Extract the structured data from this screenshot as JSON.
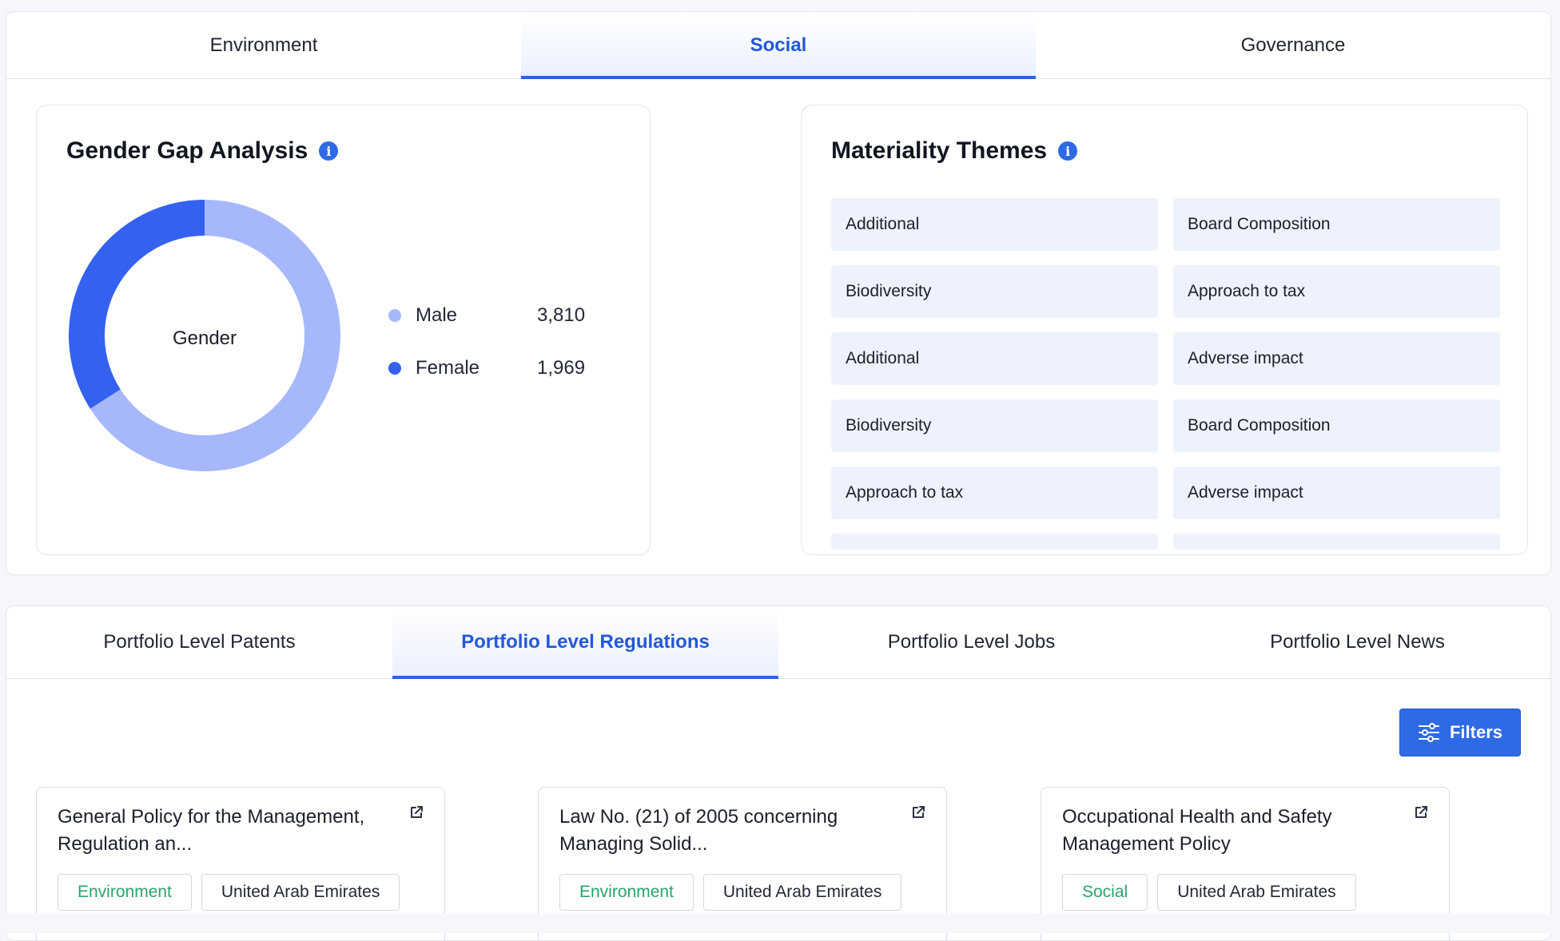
{
  "top_tabs": [
    {
      "label": "Environment",
      "active": false
    },
    {
      "label": "Social",
      "active": true
    },
    {
      "label": "Governance",
      "active": false
    }
  ],
  "gender_gap": {
    "title": "Gender Gap Analysis",
    "center_label": "Gender",
    "chart_data": {
      "type": "pie",
      "categories": [
        "Male",
        "Female"
      ],
      "values": [
        3810,
        1969
      ],
      "display_values": [
        "3,810",
        "1,969"
      ],
      "colors": [
        "#a6b8fb",
        "#3561f0"
      ]
    }
  },
  "materiality": {
    "title": "Materiality Themes",
    "items": [
      "Additional",
      "Board Composition",
      "Biodiversity",
      "Approach to tax",
      "Additional",
      "Adverse impact",
      "Biodiversity",
      "Board Composition",
      "Approach to tax",
      "Adverse impact"
    ]
  },
  "bottom_tabs": [
    {
      "label": "Portfolio Level Patents",
      "active": false
    },
    {
      "label": "Portfolio Level Regulations",
      "active": true
    },
    {
      "label": "Portfolio Level Jobs",
      "active": false
    },
    {
      "label": "Portfolio Level News",
      "active": false
    }
  ],
  "filters_label": "Filters",
  "regulations": [
    {
      "title": "General Policy for the Management, Regulation an...",
      "category": "Environment",
      "country": "United Arab Emirates"
    },
    {
      "title": "Law No. (21) of 2005 concerning Managing Solid...",
      "category": "Environment",
      "country": "United Arab Emirates"
    },
    {
      "title": "Occupational Health and Safety Management Policy",
      "category": "Social",
      "country": "United Arab Emirates"
    }
  ],
  "colors": {
    "accent": "#2f6ae6",
    "tag_green": "#2aa36a",
    "theme_bg": "#edf2fd"
  }
}
